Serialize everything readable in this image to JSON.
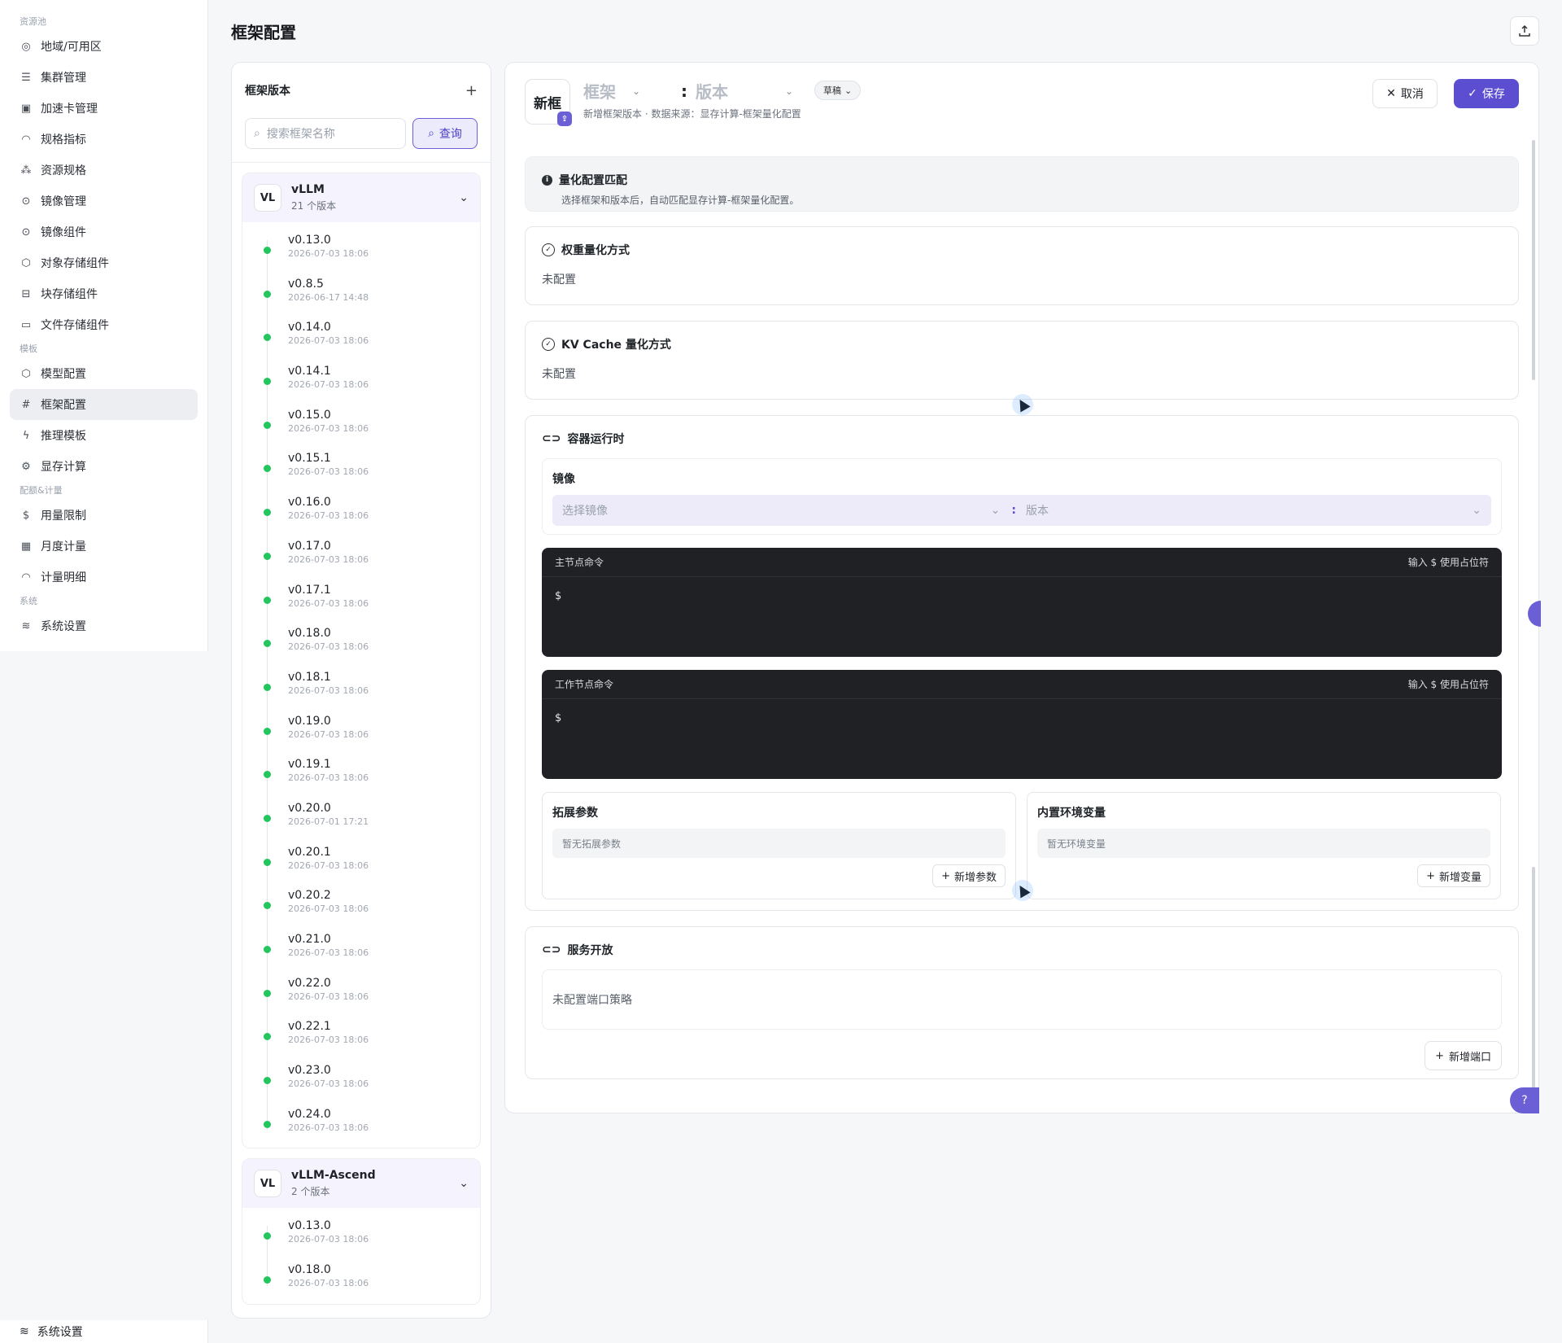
{
  "sidebar": {
    "groups": [
      {
        "label": "资源池",
        "items": [
          {
            "icon": "globe-icon",
            "glyph": "◎",
            "label": "地域/可用区"
          },
          {
            "icon": "server-icon",
            "glyph": "☰",
            "label": "集群管理"
          },
          {
            "icon": "chip-icon",
            "glyph": "▣",
            "label": "加速卡管理"
          },
          {
            "icon": "gauge-icon",
            "glyph": "◠",
            "label": "规格指标"
          },
          {
            "icon": "cubes-icon",
            "glyph": "⁂",
            "label": "资源规格"
          },
          {
            "icon": "disc-icon",
            "glyph": "⊙",
            "label": "镜像管理"
          },
          {
            "icon": "disc-icon",
            "glyph": "⊙",
            "label": "镜像组件"
          },
          {
            "icon": "box-icon",
            "glyph": "⬡",
            "label": "对象存储组件"
          },
          {
            "icon": "drive-icon",
            "glyph": "⊟",
            "label": "块存储组件"
          },
          {
            "icon": "folder-icon",
            "glyph": "▭",
            "label": "文件存储组件"
          }
        ]
      },
      {
        "label": "模板",
        "items": [
          {
            "icon": "box-icon",
            "glyph": "⬡",
            "label": "模型配置"
          },
          {
            "icon": "hash-icon",
            "glyph": "#",
            "label": "框架配置",
            "active": true
          },
          {
            "icon": "bolt-icon",
            "glyph": "ϟ",
            "label": "推理模板"
          },
          {
            "icon": "gear-icon",
            "glyph": "⚙",
            "label": "显存计算"
          }
        ]
      },
      {
        "label": "配额&计量",
        "items": [
          {
            "icon": "dollar-icon",
            "glyph": "$",
            "label": "用量限制"
          },
          {
            "icon": "calendar-icon",
            "glyph": "▦",
            "label": "月度计量"
          },
          {
            "icon": "gauge-icon",
            "glyph": "◠",
            "label": "计量明细"
          }
        ]
      },
      {
        "label": "系统",
        "items": [
          {
            "icon": "layers-icon",
            "glyph": "≋",
            "label": "系统设置"
          }
        ]
      }
    ],
    "tail_item": "系统设置"
  },
  "header": {
    "title": "框架配置"
  },
  "left_panel": {
    "title": "框架版本",
    "search_placeholder": "搜索框架名称",
    "query_label": "查询",
    "frameworks": [
      {
        "logo": "VL",
        "name": "vLLM",
        "count": "21 个版本",
        "versions": [
          {
            "name": "v0.13.0",
            "time": "2026-07-03 18:06"
          },
          {
            "name": "v0.8.5",
            "time": "2026-06-17 14:48"
          },
          {
            "name": "v0.14.0",
            "time": "2026-07-03 18:06"
          },
          {
            "name": "v0.14.1",
            "time": "2026-07-03 18:06"
          },
          {
            "name": "v0.15.0",
            "time": "2026-07-03 18:06"
          },
          {
            "name": "v0.15.1",
            "time": "2026-07-03 18:06"
          },
          {
            "name": "v0.16.0",
            "time": "2026-07-03 18:06"
          },
          {
            "name": "v0.17.0",
            "time": "2026-07-03 18:06"
          },
          {
            "name": "v0.17.1",
            "time": "2026-07-03 18:06"
          },
          {
            "name": "v0.18.0",
            "time": "2026-07-03 18:06"
          },
          {
            "name": "v0.18.1",
            "time": "2026-07-03 18:06"
          },
          {
            "name": "v0.19.0",
            "time": "2026-07-03 18:06"
          },
          {
            "name": "v0.19.1",
            "time": "2026-07-03 18:06"
          },
          {
            "name": "v0.20.0",
            "time": "2026-07-01 17:21"
          },
          {
            "name": "v0.20.1",
            "time": "2026-07-03 18:06"
          },
          {
            "name": "v0.20.2",
            "time": "2026-07-03 18:06"
          },
          {
            "name": "v0.21.0",
            "time": "2026-07-03 18:06"
          },
          {
            "name": "v0.22.0",
            "time": "2026-07-03 18:06"
          },
          {
            "name": "v0.22.1",
            "time": "2026-07-03 18:06"
          },
          {
            "name": "v0.23.0",
            "time": "2026-07-03 18:06"
          },
          {
            "name": "v0.24.0",
            "time": "2026-07-03 18:06"
          }
        ]
      },
      {
        "logo": "VL",
        "name": "vLLM-Ascend",
        "count": "2 个版本",
        "versions": [
          {
            "name": "v0.13.0",
            "time": "2026-07-03 18:06"
          },
          {
            "name": "v0.18.0",
            "time": "2026-07-03 18:06"
          }
        ]
      }
    ]
  },
  "editor": {
    "logo_text": "新框",
    "framework_placeholder": "框架",
    "version_placeholder": "版本",
    "draft_label": "草稿",
    "subtitle": "新增框架版本 · 数据来源：显存计算-框架量化配置",
    "cancel_label": "取消",
    "save_label": "保存",
    "quant_match": {
      "title": "量化配置匹配",
      "desc": "选择框架和版本后，自动匹配显存计算-框架量化配置。"
    },
    "weight_quant": {
      "title": "权重量化方式",
      "value": "未配置"
    },
    "kv_quant": {
      "title": "KV Cache 量化方式",
      "value": "未配置"
    },
    "runtime": {
      "title": "容器运行时",
      "image_label": "镜像",
      "image_placeholder": "选择镜像",
      "image_version_placeholder": "版本",
      "master_cmd": {
        "title": "主节点命令",
        "hint": "输入 $ 使用占位符",
        "prompt": "$"
      },
      "worker_cmd": {
        "title": "工作节点命令",
        "hint": "输入 $ 使用占位符",
        "prompt": "$"
      },
      "ext_params": {
        "title": "拓展参数",
        "empty": "暂无拓展参数",
        "add": "新增参数"
      },
      "env_vars": {
        "title": "内置环境变量",
        "empty": "暂无环境变量",
        "add": "新增变量"
      }
    },
    "service": {
      "title": "服务开放",
      "empty": "未配置端口策略",
      "add": "新增端口"
    }
  }
}
